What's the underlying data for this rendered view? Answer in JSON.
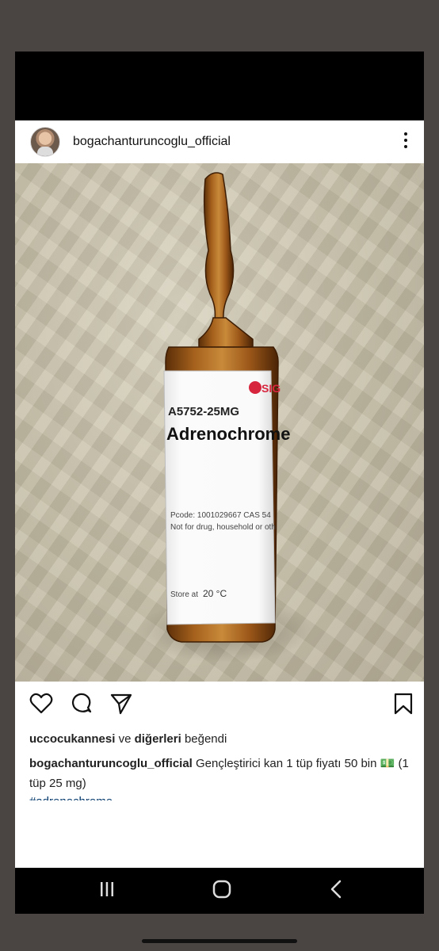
{
  "post": {
    "username": "bogachanturuncoglu_official",
    "likes": {
      "user": "uccocukannesi",
      "connector": "ve",
      "others": "diğerleri",
      "suffix": "beğendi"
    },
    "caption": {
      "author": "bogachanturuncoglu_official",
      "text_part1": "Gençleştirici kan 1 tüp fiyatı 50 bin",
      "money_emoji": "💵",
      "text_part2": "(1 tüp 25 mg)"
    },
    "hashtag": "#adrenochrome"
  },
  "photo": {
    "label_brand": "SIG",
    "product_code": "A5752-25MG",
    "product_name": "Adrenochrome",
    "pcode_line": "Pcode: 1001029667  CAS 54",
    "warning_line": "Not for drug, household or oth",
    "store_label": "Store at",
    "store_temp": "20 °C"
  },
  "icons": {
    "like": "heart-icon",
    "comment": "comment-icon",
    "share": "send-icon",
    "save": "bookmark-icon",
    "more": "more-vertical-icon",
    "recents": "recents-icon",
    "home": "home-icon",
    "back": "back-icon"
  }
}
